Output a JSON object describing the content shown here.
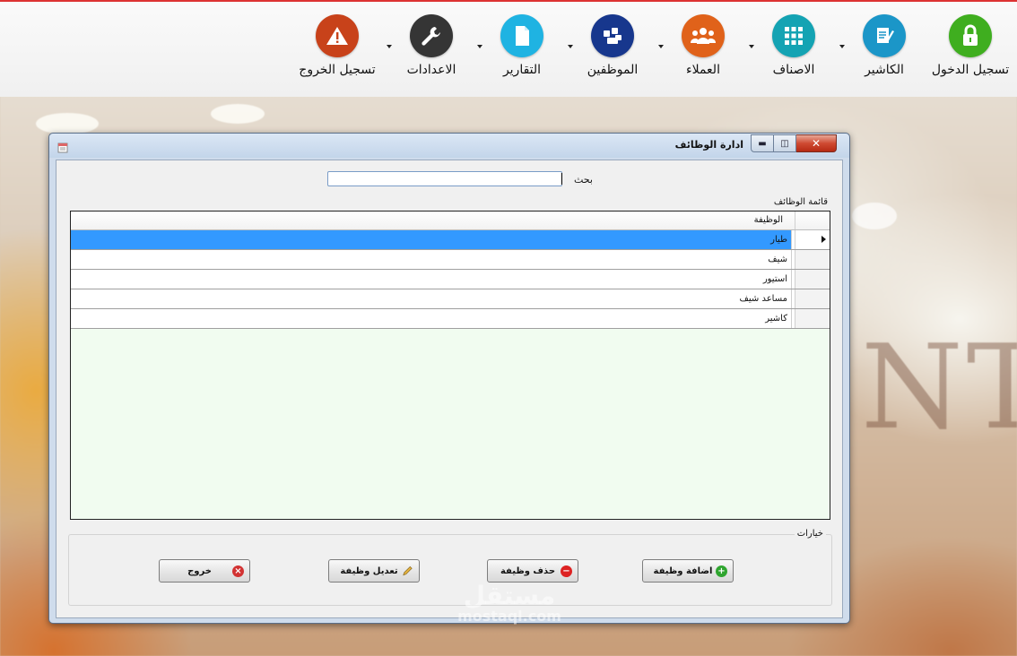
{
  "toolbar": {
    "items": [
      {
        "label": "تسجيل الدخول",
        "icon": "lock-icon",
        "color": "#3fae1f"
      },
      {
        "label": "الكاشير",
        "icon": "document-pen-icon",
        "color": "#1b96c8"
      },
      {
        "label": "الاصناف",
        "icon": "grid-icon",
        "color": "#14a3b3"
      },
      {
        "label": "العملاء",
        "icon": "group-icon",
        "color": "#e0621a"
      },
      {
        "label": "الموظفين",
        "icon": "employees-icon",
        "color": "#17378d"
      },
      {
        "label": "التقارير",
        "icon": "report-page-icon",
        "color": "#1fb3e2"
      },
      {
        "label": "الاعدادات",
        "icon": "wrench-icon",
        "color": "#353535"
      },
      {
        "label": "تسجيل الخروج",
        "icon": "warning-icon",
        "color": "#c8421a"
      }
    ]
  },
  "dialog": {
    "title": "ادارة الوظائف",
    "search_label": "بحث",
    "search_value": "",
    "list_group_title": "قائمة الوظائف",
    "column_header": "الوظيفة",
    "rows": [
      "طيار",
      "شيف",
      "استيور",
      "مساعد شيف",
      "كاشير"
    ],
    "selected_row": 0,
    "options_group_title": "خيارات",
    "buttons": {
      "add": "اضافة وظيفة",
      "delete": "حذف وظيفة",
      "edit": "تعديل وظيفة",
      "exit": "خروج"
    }
  },
  "watermark": {
    "line1": "مستقل",
    "line2": "mostaql.com"
  },
  "colors": {
    "selection": "#3399ff",
    "grid_background": "#f1fcf0",
    "close_button": "#c8412a"
  }
}
